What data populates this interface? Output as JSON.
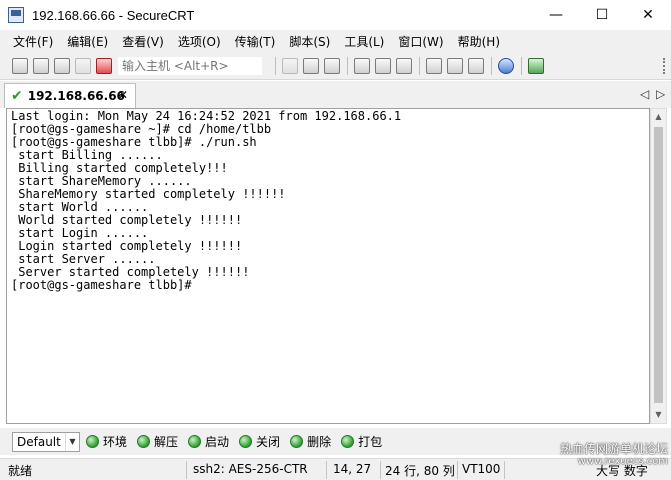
{
  "window": {
    "title": "192.168.66.66 - SecureCRT",
    "controls": {
      "minimize": "—",
      "maximize": "☐",
      "close": "✕"
    }
  },
  "menu": {
    "items": [
      "文件(F)",
      "编辑(E)",
      "查看(V)",
      "选项(O)",
      "传输(T)",
      "脚本(S)",
      "工具(L)",
      "窗口(W)",
      "帮助(H)"
    ]
  },
  "toolbar": {
    "host_input_placeholder": "输入主机 <Alt+R>"
  },
  "tabs": {
    "active": {
      "label": "192.168.66.66",
      "close": "✕",
      "status_icon": "check-icon"
    },
    "nav_prev": "◁",
    "nav_next": "▷"
  },
  "terminal": {
    "lines": [
      "Last login: Mon May 24 16:24:52 2021 from 192.168.66.1",
      "[root@gs-gameshare ~]# cd /home/tlbb",
      "[root@gs-gameshare tlbb]# ./run.sh",
      " start Billing ......",
      " Billing started completely!!!",
      " start ShareMemory ......",
      " ShareMemory started completely !!!!!!",
      " start World ......",
      " World started completely !!!!!!",
      " start Login ......",
      " Login started completely !!!!!!",
      " start Server ......",
      " Server started completely !!!!!!",
      "[root@gs-gameshare tlbb]#"
    ]
  },
  "scrollbar": {
    "up": "▲",
    "down": "▼"
  },
  "button_bar": {
    "session_select": "Default",
    "select_arrow": "▼",
    "buttons": [
      "环境",
      "解压",
      "启动",
      "关闭",
      "删除",
      "打包"
    ]
  },
  "status_bar": {
    "ready": "就绪",
    "encryption": "ssh2: AES-256-CTR",
    "cursor": "14,  27",
    "size": "24 行, 80 列",
    "terminal_type": "VT100",
    "keyboard": "大写  数字"
  },
  "watermark": {
    "line1": "热血传网游单机论坛",
    "line2": "www.rexuecs.com"
  }
}
